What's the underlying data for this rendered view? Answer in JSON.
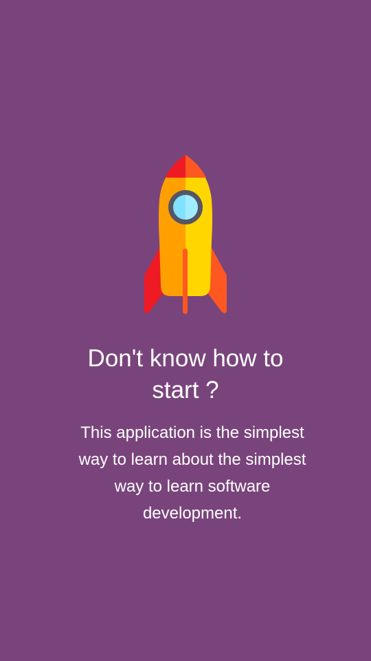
{
  "onboarding": {
    "illustration": "rocket-illustration",
    "title": "Don't know how to\nstart ?",
    "description": "This application is the simplest\nway to learn about the simplest\nway to learn software\ndevelopment."
  },
  "colors": {
    "background": "#79447B",
    "text": "#FFFFFF",
    "rocket_body_left": "#FFA000",
    "rocket_body_right": "#FFD600",
    "rocket_nose_left": "#EE1B24",
    "rocket_nose_right": "#FF5722",
    "window_ring": "#555566",
    "window_glass": "#7FE3FF"
  }
}
